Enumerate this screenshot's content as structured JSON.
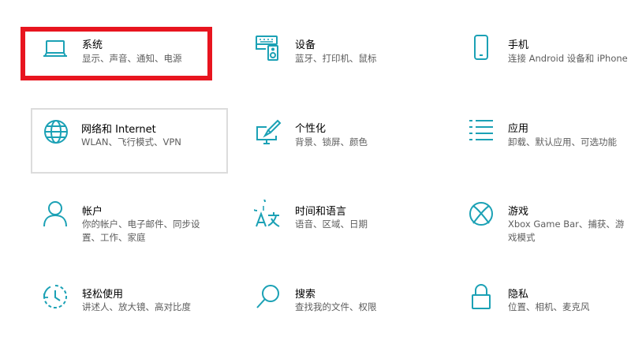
{
  "accent_color": "#1ba1b5",
  "highlight_color": "#e8151f",
  "tiles": [
    {
      "title": "系统",
      "desc": "显示、声音、通知、电源",
      "icon": "laptop-icon"
    },
    {
      "title": "设备",
      "desc": "蓝牙、打印机、鼠标",
      "icon": "keyboard-speaker-icon"
    },
    {
      "title": "手机",
      "desc": "连接 Android 设备和 iPhone",
      "icon": "phone-icon"
    },
    {
      "title": "网络和 Internet",
      "desc": "WLAN、飞行模式、VPN",
      "icon": "globe-icon"
    },
    {
      "title": "个性化",
      "desc": "背景、锁屏、颜色",
      "icon": "paint-display-icon"
    },
    {
      "title": "应用",
      "desc": "卸载、默认应用、可选功能",
      "icon": "apps-list-icon"
    },
    {
      "title": "帐户",
      "desc": "你的帐户、电子邮件、同步设置、工作、家庭",
      "icon": "person-icon"
    },
    {
      "title": "时间和语言",
      "desc": "语音、区域、日期",
      "icon": "time-language-icon"
    },
    {
      "title": "游戏",
      "desc": "Xbox Game Bar、捕获、游戏模式",
      "icon": "xbox-icon"
    },
    {
      "title": "轻松使用",
      "desc": "讲述人、放大镜、高对比度",
      "icon": "ease-of-access-icon"
    },
    {
      "title": "搜索",
      "desc": "查找我的文件、权限",
      "icon": "search-icon"
    },
    {
      "title": "隐私",
      "desc": "位置、相机、麦克风",
      "icon": "lock-icon"
    }
  ]
}
